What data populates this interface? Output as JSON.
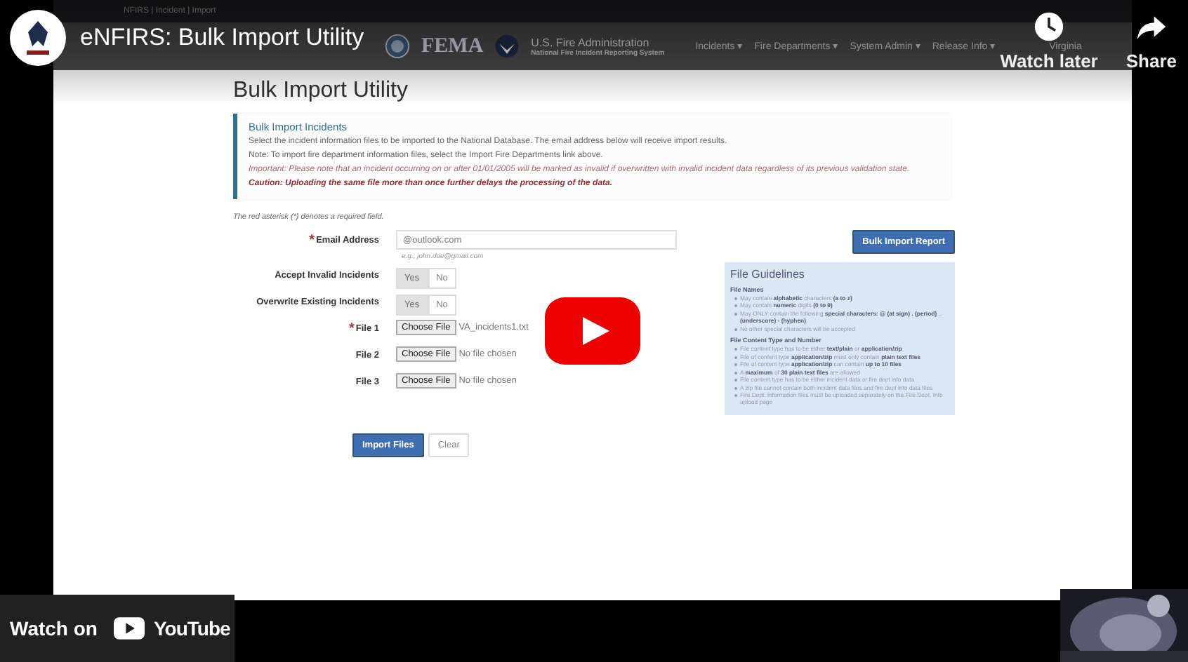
{
  "player": {
    "title": "eNFIRS: Bulk Import Utility",
    "watch_later": "Watch later",
    "share": "Share",
    "watch_on": "Watch on",
    "youtube": "YouTube"
  },
  "browser_tab": {
    "title": "NFIRS | Incident | Import"
  },
  "site_nav": {
    "agency": "FEMA",
    "org_title": "U.S. Fire Administration",
    "org_subtitle": "National Fire Incident Reporting System",
    "menus": [
      "Incidents ▾",
      "Fire Departments ▾",
      "System Admin ▾",
      "Release Info ▾"
    ],
    "state": "Virginia"
  },
  "heading": "Bulk Import Utility",
  "info": {
    "title": "Bulk Import Incidents",
    "lines": [
      {
        "kind": "plain",
        "text": "Select the incident information files to be imported to the National Database. The email address below will receive import results."
      },
      {
        "kind": "plain",
        "text": "Note: To import fire department information files, select the Import Fire Departments link above."
      },
      {
        "kind": "important",
        "text": "Important: Please note that an incident occurring on or after 01/01/2005 will be marked as invalid if overwritten with invalid incident data regardless of its previous validation state."
      },
      {
        "kind": "caution",
        "text": "Caution: Uploading the same file more than once further delays the processing of the data."
      }
    ]
  },
  "required_note": "The red asterisk (*) denotes a required field.",
  "required_mark": "*",
  "form": {
    "rows": [
      {
        "kind": "text",
        "label": "Email Address",
        "required": true,
        "value": "@outlook.com",
        "hint": "e.g., john.doe@gmail.com"
      },
      {
        "kind": "toggle",
        "label": "Accept Invalid Incidents",
        "required": false,
        "options": [
          {
            "label": "Yes",
            "selected": true
          },
          {
            "label": "No",
            "selected": false
          }
        ]
      },
      {
        "kind": "toggle",
        "label": "Overwrite Existing Incidents",
        "required": false,
        "options": [
          {
            "label": "Yes",
            "selected": true
          },
          {
            "label": "No",
            "selected": false
          }
        ]
      },
      {
        "kind": "file",
        "label": "File 1",
        "required": true,
        "button": "Choose File",
        "file": "VA_incidents1.txt"
      },
      {
        "kind": "file",
        "label": "File 2",
        "required": false,
        "button": "Choose File",
        "file": "No file chosen"
      },
      {
        "kind": "file",
        "label": "File 3",
        "required": false,
        "button": "Choose File",
        "file": "No file chosen"
      }
    ],
    "buttons": [
      {
        "label": "Import Files",
        "kind": "primary"
      },
      {
        "label": "Clear",
        "kind": "default"
      }
    ]
  },
  "report_button": "Bulk Import Report",
  "guidelines": {
    "title": "File Guidelines",
    "sections": [
      {
        "title": "File Names",
        "items": [
          "May contain **alphabetic** characters **(a to z)**",
          "May contain **numeric** digits **(0 to 9)**",
          "May ONLY contain the following **special characters: @ (at sign) . (period) _ (underscore) - (hyphen)**",
          "No other special characters will be accepted"
        ]
      },
      {
        "title": "File Content Type and Number",
        "items": [
          "File content type has to be either **text/plain** or **application/zip**",
          "File of content type **application/zip** must only contain **plain text files**",
          "File of content type **application/zip** can contain **up to 10 files**",
          "A **maximum** of **30 plain text files** are allowed",
          "File content type has to be either incident data or fire dept info data",
          "A zip file cannot contain both incident data files and fire dept info data files",
          "Fire Dept. information files must be uploaded separately on the Fire Dept. Info upload page"
        ]
      }
    ]
  }
}
